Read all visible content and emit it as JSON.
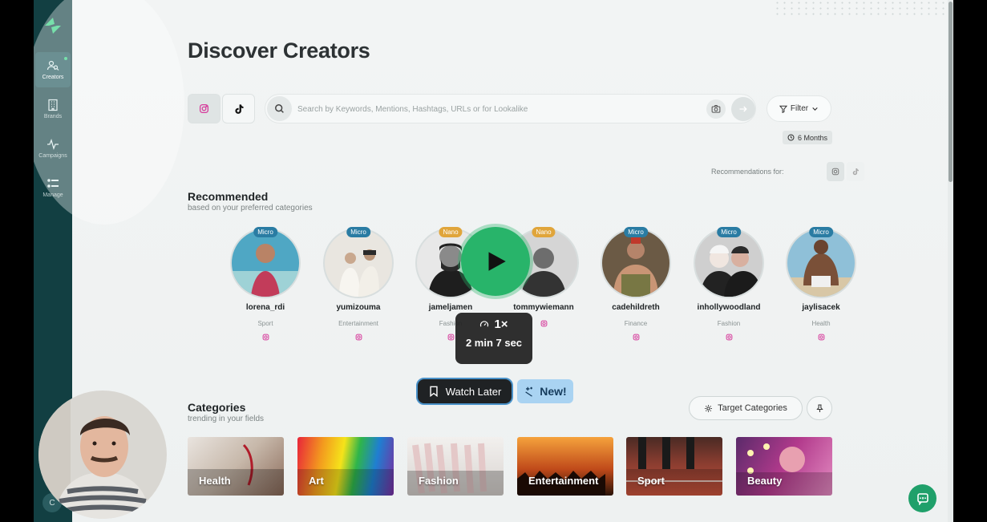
{
  "nav": {
    "items": [
      {
        "label": "Creators",
        "icon": "creators-icon",
        "active": true
      },
      {
        "label": "Brands",
        "icon": "building-icon"
      },
      {
        "label": "Campaigns",
        "icon": "pulse-icon"
      },
      {
        "label": "Manage",
        "icon": "list-icon"
      }
    ],
    "avatar_initial": "C"
  },
  "page": {
    "title": "Discover Creators"
  },
  "search": {
    "placeholder": "Search by Keywords, Mentions, Hashtags, URLs or for Lookalike",
    "value": ""
  },
  "filter": {
    "label": "Filter"
  },
  "time_range": {
    "label": "6 Months"
  },
  "recommendations_for": {
    "label": "Recommendations for:"
  },
  "recommended": {
    "title": "Recommended",
    "subtitle": "based on your preferred categories",
    "creators": [
      {
        "tier": "Micro",
        "name": "lorena_rdi",
        "category": "Sport"
      },
      {
        "tier": "Micro",
        "name": "yumizouma",
        "category": "Entertainment"
      },
      {
        "tier": "Nano",
        "name": "jameljamen",
        "category": "Fashion"
      },
      {
        "tier": "Nano",
        "name": "tommywiemann",
        "category": ""
      },
      {
        "tier": "Micro",
        "name": "cadehildreth",
        "category": "Finance"
      },
      {
        "tier": "Micro",
        "name": "inhollywoodland",
        "category": "Fashion"
      },
      {
        "tier": "Micro",
        "name": "jaylisacek",
        "category": "Health"
      }
    ]
  },
  "categories": {
    "title": "Categories",
    "subtitle": "trending in your fields",
    "target_label": "Target Categories",
    "items": [
      {
        "label": "Health"
      },
      {
        "label": "Art"
      },
      {
        "label": "Fashion"
      },
      {
        "label": "Entertainment"
      },
      {
        "label": "Sport"
      },
      {
        "label": "Beauty"
      }
    ]
  },
  "video_overlay": {
    "speed": "1×",
    "duration": "2 min 7 sec",
    "watch_later": "Watch Later",
    "new_badge": "New!"
  },
  "colors": {
    "sidebar": "#123f42",
    "accent_green": "#28b46a",
    "tier_micro": "#2a7ca3",
    "tier_nano": "#e0a53b"
  }
}
